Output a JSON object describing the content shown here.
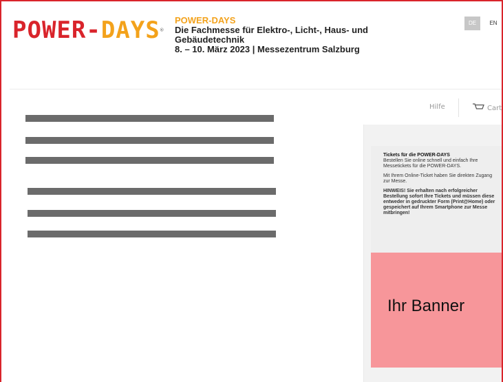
{
  "header": {
    "logo_power": "POWER-",
    "logo_days": "DAYS",
    "logo_reg": "®",
    "event_title": "POWER-DAYS",
    "event_subtitle": "Die Fachmesse für Elektro-, Licht-, Haus- und Gebäudetechnik",
    "event_date": "8. – 10. März 2023 | Messezentrum Salzburg"
  },
  "lang": {
    "de": "DE",
    "en": "EN"
  },
  "nav": {
    "help": "Hilfe",
    "cart": "Cart"
  },
  "sidebar": {
    "title": "Tickets für die POWER-DAYS",
    "intro": "Bestellen Sie online schnell und einfach Ihre Messetickets für die POWER-DAYS.",
    "online": "Mit Ihrem Online-Ticket haben Sie direkten Zugang zur Messe.",
    "notice": "HINWEIS! Sie erhalten nach erfolgreicher Bestellung sofort Ihre Tickets und müssen diese entweder in gedruckter Form (Print@Home) oder gespeichert auf Ihrem Smartphone zur Messe mitbringen!"
  },
  "banner": {
    "label": "Ihr Banner"
  },
  "colors": {
    "brand_red": "#d9242b",
    "brand_orange": "#f3a21b",
    "banner_pink": "#f7969a",
    "redaction_gray": "#6b6b6b"
  }
}
